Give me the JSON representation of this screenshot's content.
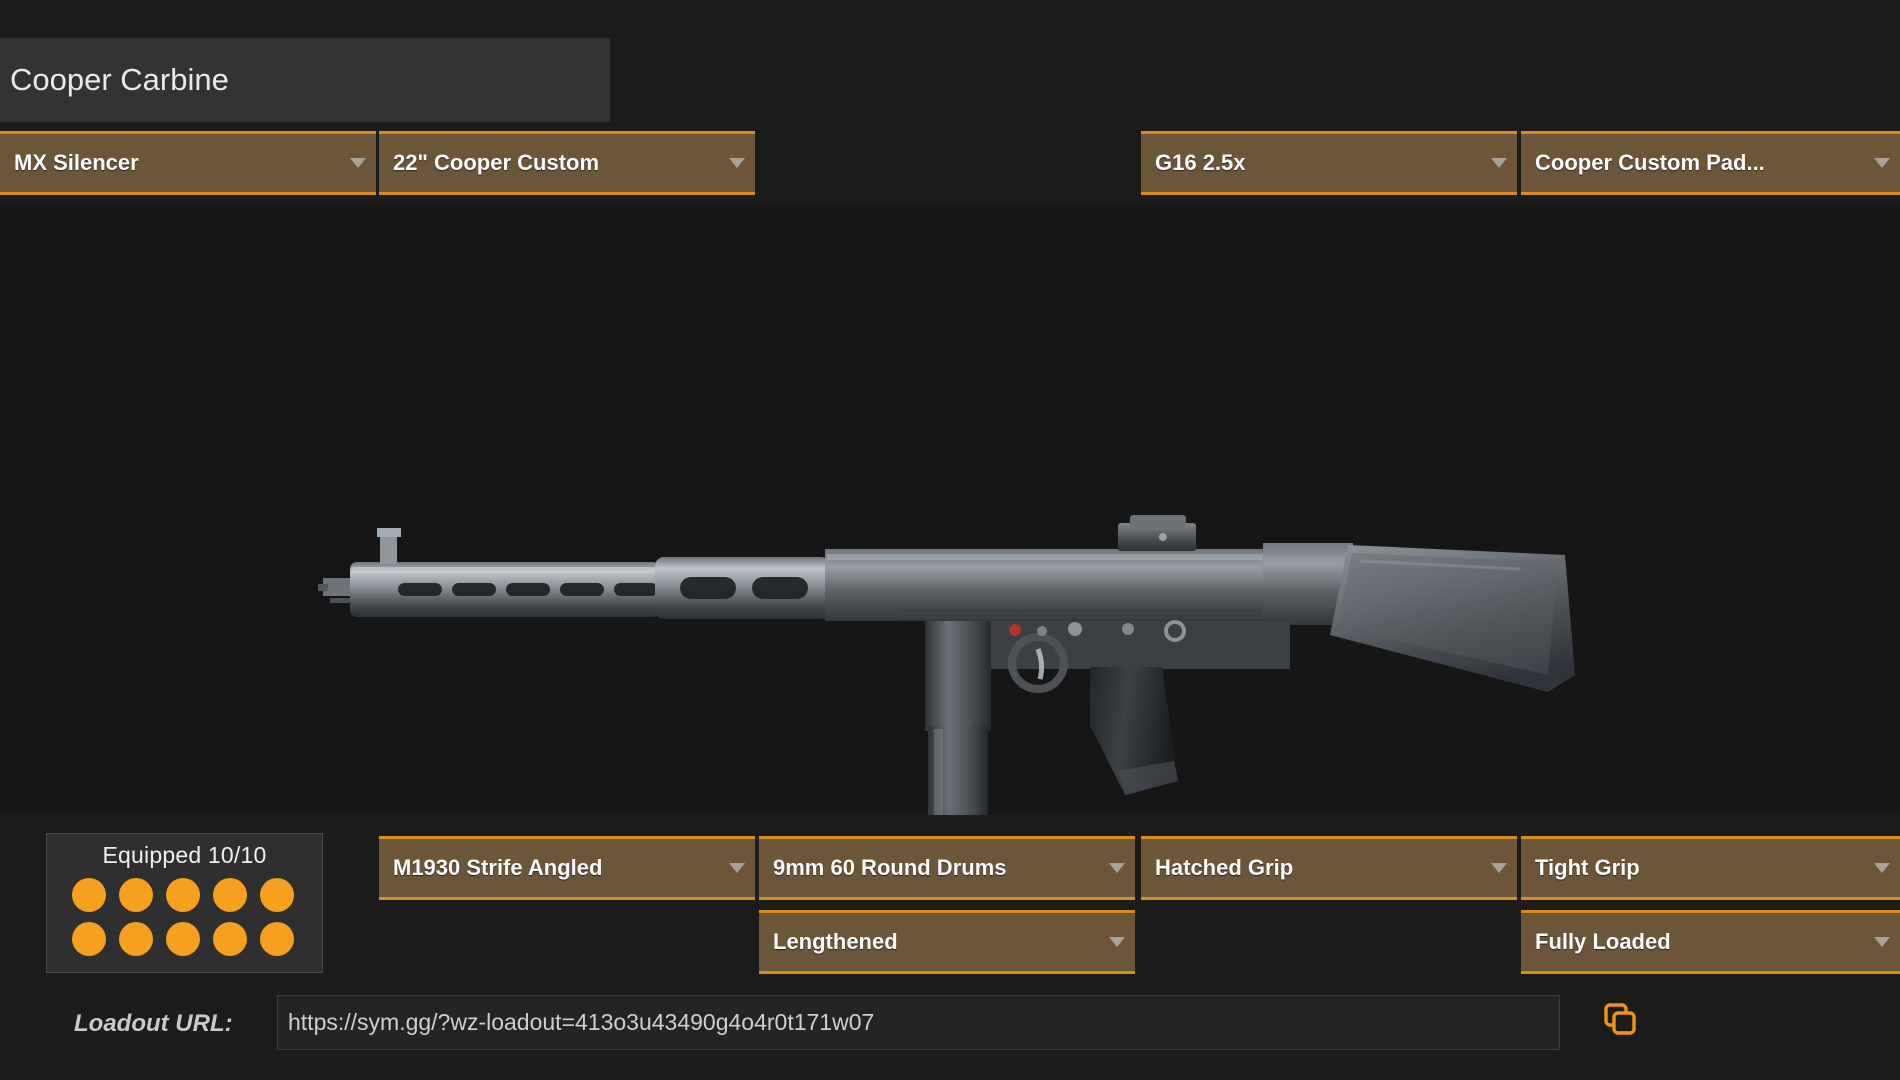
{
  "app": {
    "background_color": "#1c1c1c",
    "accent_color": "#d88c1a",
    "dropdown_fill_color": "#6b563a",
    "dot_color": "#f5a01e"
  },
  "weapon": {
    "name": "Cooper Carbine",
    "name_placeholder": "Weapon Name"
  },
  "attachments_top": [
    {
      "label": "MX Silencer",
      "slot": "muzzle"
    },
    {
      "label": "22\" Cooper Custom",
      "slot": "barrel"
    },
    {
      "label": "G16 2.5x",
      "slot": "optic"
    },
    {
      "label": "Cooper Custom Pad...",
      "slot": "stock"
    }
  ],
  "attachments_bottom": [
    {
      "label": "M1930 Strife Angled",
      "slot": "underbarrel"
    },
    {
      "label": "9mm 60 Round Drums",
      "slot": "magazine"
    },
    {
      "label": "Hatched Grip",
      "slot": "rear-grip"
    },
    {
      "label": "Tight Grip",
      "slot": "perk-1"
    },
    {
      "label": "Lengthened",
      "slot": "ammo-type"
    },
    {
      "label": "Fully Loaded",
      "slot": "perk-2"
    }
  ],
  "equipped": {
    "label": "Equipped 10/10",
    "count": 10,
    "max": 10
  },
  "loadout_url": {
    "label": "Loadout URL:",
    "value": "https://sym.gg/?wz-loadout=413o3u43490g4o4r0t171w07",
    "placeholder": "Loadout URL",
    "copy_icon": "copy-icon"
  }
}
